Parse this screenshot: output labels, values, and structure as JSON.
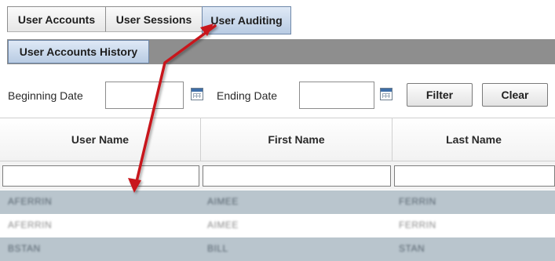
{
  "tabs": [
    {
      "label": "User Accounts"
    },
    {
      "label": "User Sessions"
    },
    {
      "label": "User Auditing"
    }
  ],
  "subtabs": [
    {
      "label": "User Accounts History"
    }
  ],
  "filter": {
    "beginning_label": "Beginning Date",
    "ending_label": "Ending Date",
    "beginning_value": "",
    "ending_value": "",
    "filter_button": "Filter",
    "clear_button": "Clear"
  },
  "grid": {
    "columns": [
      {
        "label": "User Name"
      },
      {
        "label": "First Name"
      },
      {
        "label": "Last Name"
      }
    ],
    "rows": [
      {
        "user": "AFERRIN",
        "first": "AIMEE",
        "last": "FERRIN"
      },
      {
        "user": "AFERRIN",
        "first": "AIMEE",
        "last": "FERRIN"
      },
      {
        "user": "BSTAN",
        "first": "BILL",
        "last": "STAN"
      }
    ]
  },
  "annotation": {
    "arrow_color": "#c8181e"
  }
}
